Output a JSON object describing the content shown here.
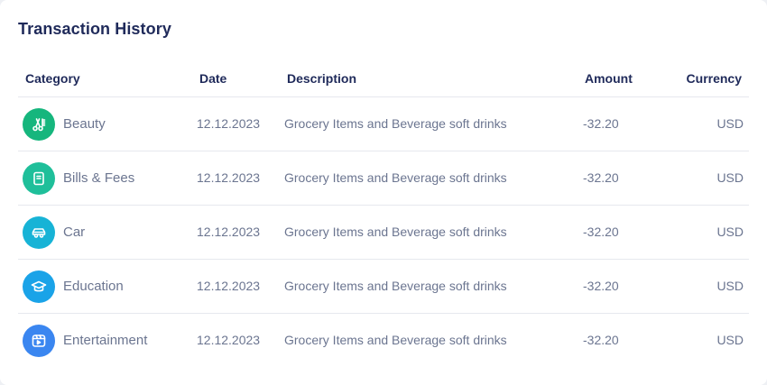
{
  "title": "Transaction History",
  "columns": {
    "category": "Category",
    "date": "Date",
    "description": "Description",
    "amount": "Amount",
    "currency": "Currency"
  },
  "rows": [
    {
      "category": "Beauty",
      "icon": "scissors-comb-icon",
      "color": "#16b67d",
      "date": "12.12.2023",
      "description": "Grocery Items and Beverage soft drinks",
      "amount": "-32.20",
      "currency": "USD"
    },
    {
      "category": "Bills & Fees",
      "icon": "receipt-icon",
      "color": "#1fbf9a",
      "date": "12.12.2023",
      "description": "Grocery Items and Beverage soft drinks",
      "amount": "-32.20",
      "currency": "USD"
    },
    {
      "category": "Car",
      "icon": "car-icon",
      "color": "#17b3d6",
      "date": "12.12.2023",
      "description": "Grocery Items and Beverage soft drinks",
      "amount": "-32.20",
      "currency": "USD"
    },
    {
      "category": "Education",
      "icon": "graduation-cap-icon",
      "color": "#1aa3e8",
      "date": "12.12.2023",
      "description": "Grocery Items and Beverage soft drinks",
      "amount": "-32.20",
      "currency": "USD"
    },
    {
      "category": "Entertainment",
      "icon": "video-play-icon",
      "color": "#3a86f0",
      "date": "12.12.2023",
      "description": "Grocery Items and Beverage soft drinks",
      "amount": "-32.20",
      "currency": "USD"
    }
  ]
}
